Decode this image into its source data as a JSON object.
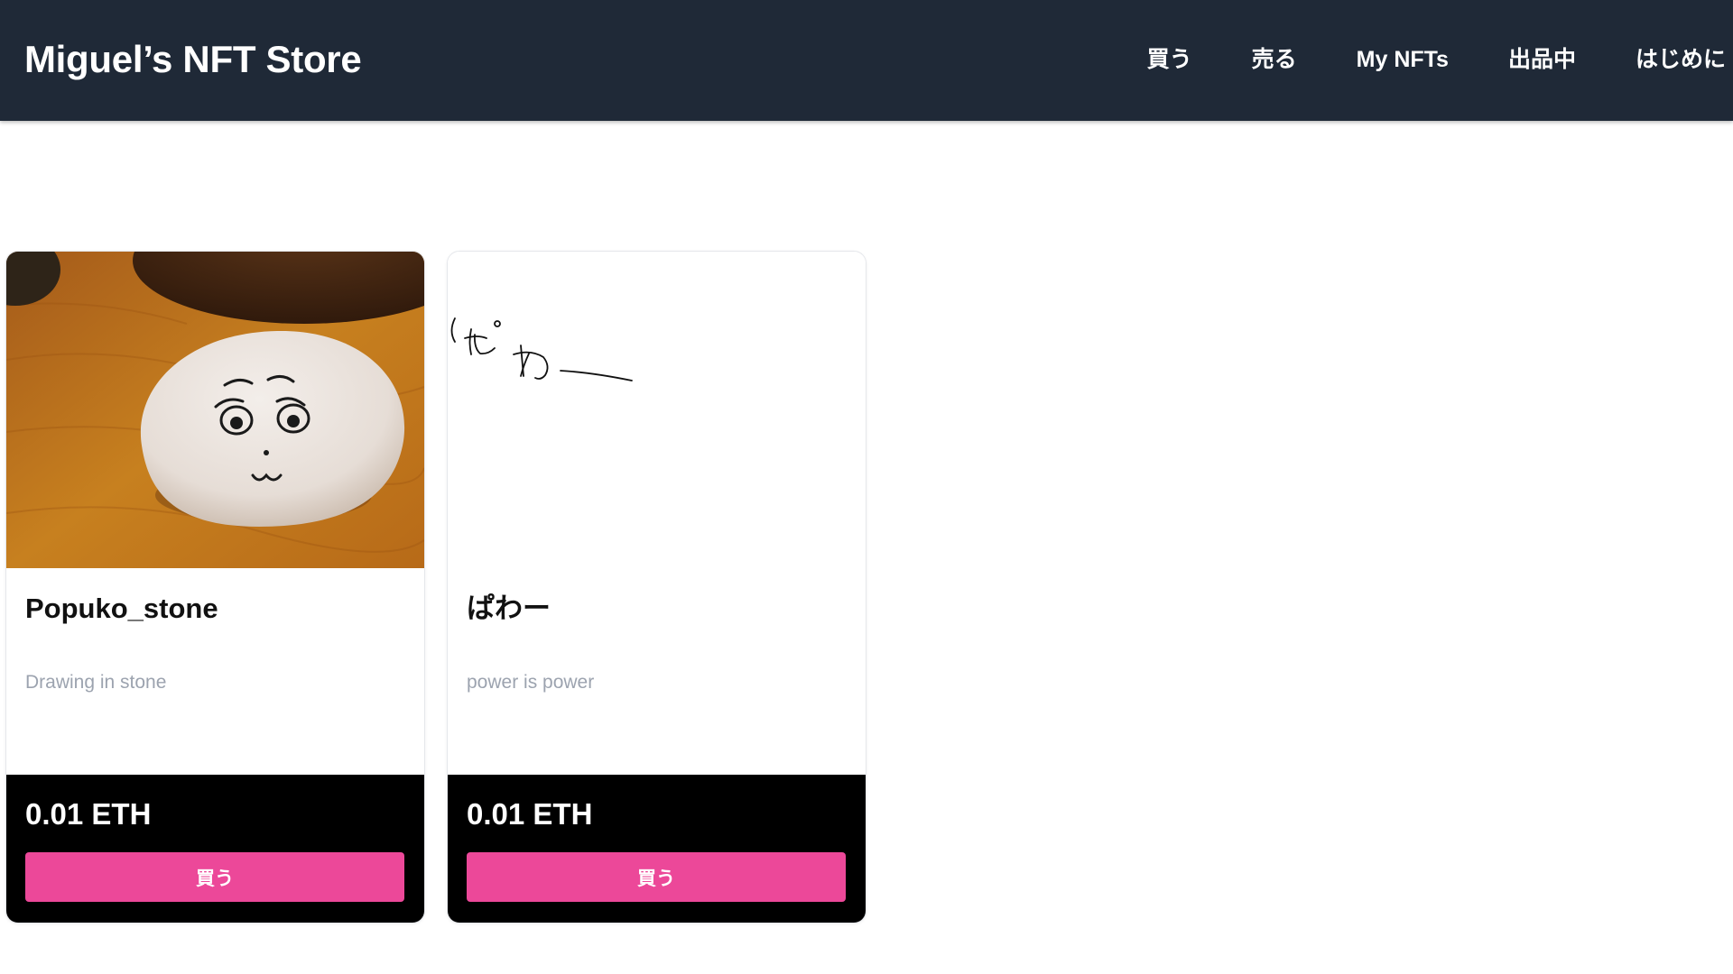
{
  "header": {
    "title": "Miguel’s NFT Store",
    "nav": [
      {
        "label": "買う"
      },
      {
        "label": "売る"
      },
      {
        "label": "My NFTs"
      },
      {
        "label": "出品中"
      },
      {
        "label": "はじめに"
      }
    ]
  },
  "items": [
    {
      "name": "Popuko_stone",
      "description": "Drawing in stone",
      "price": "0.01 ETH",
      "buy_label": "買う"
    },
    {
      "name": "ぱわー",
      "description": "power is power",
      "price": "0.01 ETH",
      "buy_label": "買う"
    }
  ],
  "colors": {
    "navbar": "#1f2937",
    "buy_button": "#ec4899",
    "card_footer": "#000000",
    "description_text": "#9ca3af"
  }
}
